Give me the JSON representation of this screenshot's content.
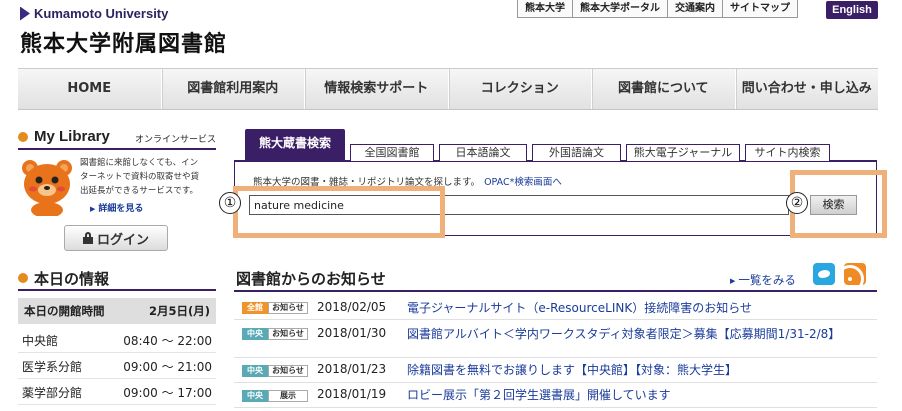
{
  "header": {
    "university_name": "Kumamoto University",
    "library_title": "熊本大学附属図書館",
    "top_links": [
      "熊本大学",
      "熊本大学ポータル",
      "交通案内",
      "サイトマップ"
    ],
    "english_label": "English"
  },
  "global_nav": [
    "HOME",
    "図書館利用案内",
    "情報検索サポート",
    "コレクション",
    "図書館について",
    "問い合わせ・申し込み"
  ],
  "my_library": {
    "title": "My Library",
    "subtitle": "オンラインサービス",
    "description_lines": [
      "図書館に来館しなくても、イン",
      "ターネットで資料の取寄せや貸",
      "出延長ができるサービスです。"
    ],
    "details_link": "詳細を見る",
    "login_label": "ログイン"
  },
  "today_info": {
    "title": "本日の情報",
    "hours_label": "本日の開館時間",
    "date": "2月5日(月)",
    "branches": [
      {
        "name": "中央館",
        "hours": "08:40 ～ 22:00"
      },
      {
        "name": "医学系分館",
        "hours": "09:00 ～ 21:00"
      },
      {
        "name": "薬学部分館",
        "hours": "09:00 ～ 17:00"
      }
    ]
  },
  "search": {
    "active_tab": "熊大蔵書検索",
    "tabs": [
      "全国図書館",
      "日本語論文",
      "外国語論文",
      "熊大電子ジャーナル",
      "サイト内検索"
    ],
    "description": "熊本大学の図書・雑誌・リポジトリ論文を探します。",
    "opac_link": "OPAC*検索画面へ",
    "query": "nature medicine",
    "button_label": "検索",
    "callouts": [
      "①",
      "②"
    ],
    "callout_color": "#f0b07a"
  },
  "news": {
    "title": "図書館からのお知らせ",
    "more_link": "一覧をみる",
    "items": [
      {
        "category": "全館",
        "kind": "お知らせ",
        "date": "2018/02/05",
        "title": "電子ジャーナルサイト（e-ResourceLINK）接続障害のお知らせ"
      },
      {
        "category": "中央",
        "kind": "お知らせ",
        "date": "2018/01/30",
        "title": "図書館アルバイト＜学内ワークスタディ対象者限定＞募集【応募期間1/31-2/8】"
      },
      {
        "category": "中央",
        "kind": "お知らせ",
        "date": "2018/01/23",
        "title": "除籍図書を無料でお譲りします【中央館】【対象：熊大学生】"
      },
      {
        "category": "中央",
        "kind": "展示",
        "date": "2018/01/19",
        "title": "ロビー展示「第２回学生選書展」開催しています"
      }
    ]
  },
  "colors": {
    "brand_purple": "#3a1e66",
    "accent_orange": "#e58a1f",
    "link_blue": "#1a3c9a"
  }
}
